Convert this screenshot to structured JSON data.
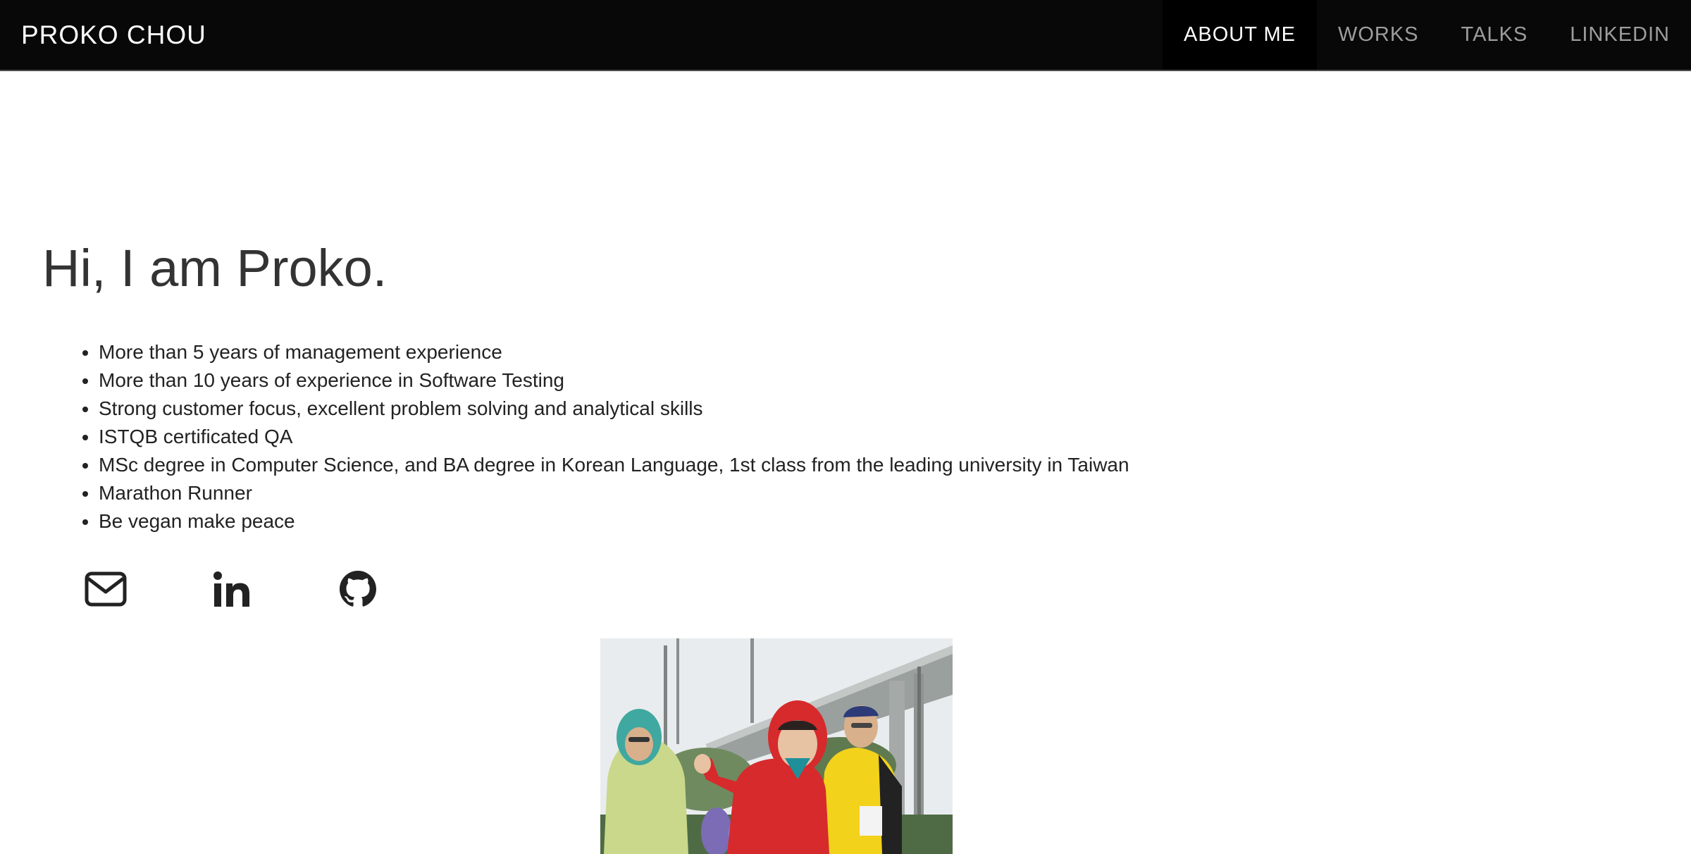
{
  "brand": {
    "name": "PROKO CHOU"
  },
  "nav": {
    "items": [
      {
        "label": "ABOUT ME",
        "active": true
      },
      {
        "label": "WORKS",
        "active": false
      },
      {
        "label": "TALKS",
        "active": false
      },
      {
        "label": "LINKEDIN",
        "active": false
      }
    ]
  },
  "about": {
    "heading": "Hi, I am Proko.",
    "bullets": [
      "More than 5 years of management experience",
      "More than 10 years of experience in Software Testing",
      "Strong customer focus, excellent problem solving and analytical skills",
      "ISTQB certificated QA",
      "MSc degree in Computer Science, and BA degree in Korean Language, 1st class from the leading university in Taiwan",
      "Marathon Runner",
      "Be vegan make peace"
    ]
  },
  "social": {
    "icons": [
      "envelope-icon",
      "linkedin-icon",
      "github-icon"
    ]
  },
  "photo": {
    "subject": "marathon runners in rain jackets"
  },
  "colors": {
    "navbar_bg": "#080808",
    "nav_active_bg": "#000000",
    "nav_text": "#9d9d9d",
    "text": "#333333",
    "jacket_red": "#d62a2c",
    "jacket_yellow": "#f2d21a"
  }
}
